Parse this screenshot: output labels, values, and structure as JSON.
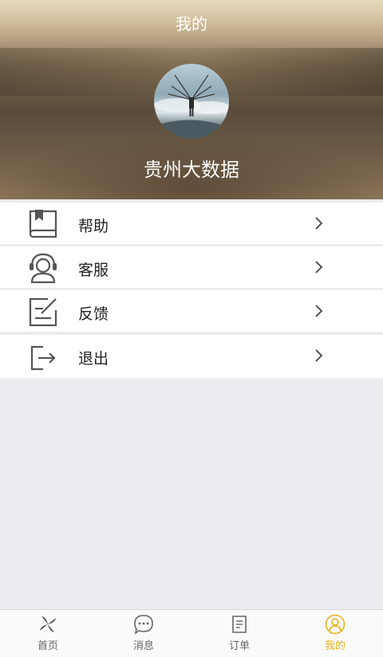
{
  "header": {
    "title": "我的",
    "username": "贵州大数据"
  },
  "menu": [
    {
      "label": "帮助",
      "icon": "book-icon"
    },
    {
      "label": "客服",
      "icon": "headset-user-icon"
    },
    {
      "label": "反馈",
      "icon": "edit-feedback-icon"
    },
    {
      "label": "退出",
      "icon": "logout-icon"
    }
  ],
  "tabbar": [
    {
      "label": "首页",
      "icon": "home-pinwheel-icon",
      "active": false
    },
    {
      "label": "消息",
      "icon": "chat-bubble-icon",
      "active": false
    },
    {
      "label": "订单",
      "icon": "order-document-icon",
      "active": false
    },
    {
      "label": "我的",
      "icon": "user-profile-icon",
      "active": true
    }
  ],
  "colors": {
    "accent": "#e9b21c",
    "background": "#ebebf0",
    "tab_inactive": "#666666"
  }
}
